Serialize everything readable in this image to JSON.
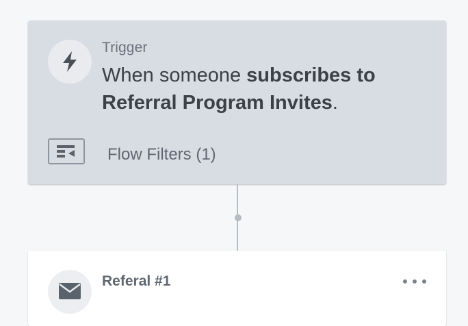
{
  "trigger": {
    "eyebrow": "Trigger",
    "description_prefix": "When someone ",
    "description_bold_1": "subscribes to",
    "description_bold_2": "Referral Program Invites",
    "description_suffix": ".",
    "icon": "lightning-bolt-icon",
    "filters_icon": "flow-filters-icon",
    "filters_label": "Flow Filters (1)"
  },
  "email_step": {
    "title": "Referal #1",
    "icon": "envelope-icon",
    "menu_icon": "more-options-icon"
  },
  "colors": {
    "canvas_bg": "#f6f7f9",
    "trigger_card_bg": "#d8dde4",
    "email_card_bg": "#ffffff",
    "text_dark": "#3b4148",
    "text_muted": "#6a727c",
    "connector": "#b5bcc4"
  }
}
